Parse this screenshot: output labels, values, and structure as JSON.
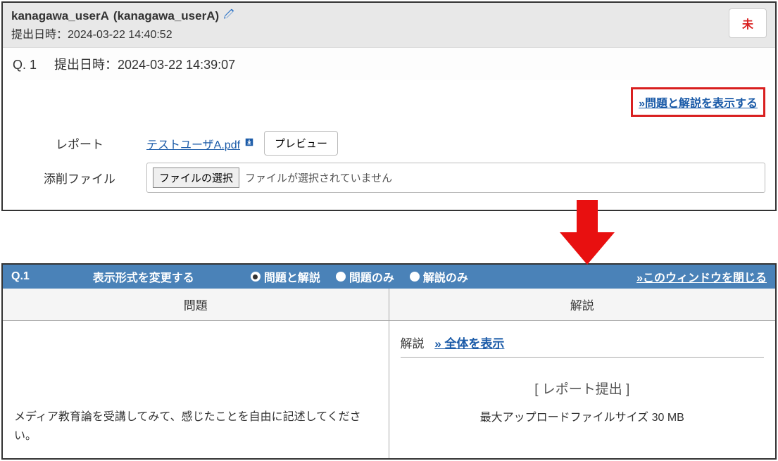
{
  "top": {
    "user_name": "kanagawa_userA",
    "user_id": "(kanagawa_userA)",
    "submission_label": "提出日時：",
    "submission_datetime": "2024-03-22 14:40:52",
    "status_badge": "未",
    "question_label": "Q. 1",
    "question_time_label": "提出日時：",
    "question_time": "2024-03-22 14:39:07",
    "show_explanation_link": "»問題と解説を表示する",
    "report_label": "レポート",
    "file_name": "テストユーザA.pdf",
    "preview_btn": "プレビュー",
    "correction_label": "添削ファイル",
    "choose_file_btn": "ファイルの選択",
    "no_file_text": "ファイルが選択されていません"
  },
  "bottom": {
    "q_label": "Q.1",
    "format_label": "表示形式を変更する",
    "radio": {
      "opt1": "問題と解説",
      "opt2": "問題のみ",
      "opt3": "解説のみ"
    },
    "close_link": "»このウィンドウを閉じる",
    "col_problem": "問題",
    "col_explanation": "解説",
    "question_text": "メディア教育論を受講してみて、感じたことを自由に記述してください。",
    "expl_label": "解説",
    "expl_show_all": "» 全体を表示",
    "report_submit_title": "[ レポート提出 ]",
    "max_upload": "最大アップロードファイルサイズ 30 MB"
  }
}
